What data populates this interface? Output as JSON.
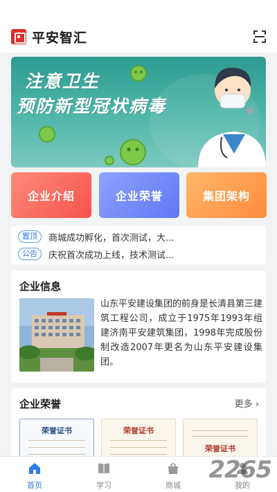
{
  "header": {
    "title": "平安智汇",
    "scan_icon": "scan-icon"
  },
  "banner": {
    "line1": "注意卫生",
    "line2": "预防新型冠状病毒"
  },
  "quick_buttons": [
    {
      "label": "企业介绍",
      "color": "#f5534c"
    },
    {
      "label": "企业荣誉",
      "color": "#5f78f2"
    },
    {
      "label": "集团架构",
      "color": "#ff8a3a"
    }
  ],
  "notices": [
    {
      "tag": "置顶",
      "text": "商城成功孵化，首次测试，大..."
    },
    {
      "tag": "公告",
      "text": "庆祝首次成功上线，技术测试..."
    }
  ],
  "company_info": {
    "title": "企业信息",
    "text": "山东平安建设集团的前身是长清县第三建筑工程公司，成立于1975年1993年组建济南平安建筑集团，1998年完成股份制改造2007年更名为山东平安建设集团。"
  },
  "honors": {
    "title": "企业荣誉",
    "more": "更多",
    "certificates": [
      "荣誉证书",
      "荣誉证书",
      "荣誉证书"
    ]
  },
  "tabs": [
    {
      "label": "首页",
      "icon": "home-icon",
      "active": true
    },
    {
      "label": "学习",
      "icon": "book-icon",
      "active": false
    },
    {
      "label": "商城",
      "icon": "shop-icon",
      "active": false
    },
    {
      "label": "我的",
      "icon": "user-icon",
      "active": false
    }
  ],
  "watermark": "2265",
  "colors": {
    "accent": "#2f7be5",
    "logo": "#e02b2b"
  }
}
